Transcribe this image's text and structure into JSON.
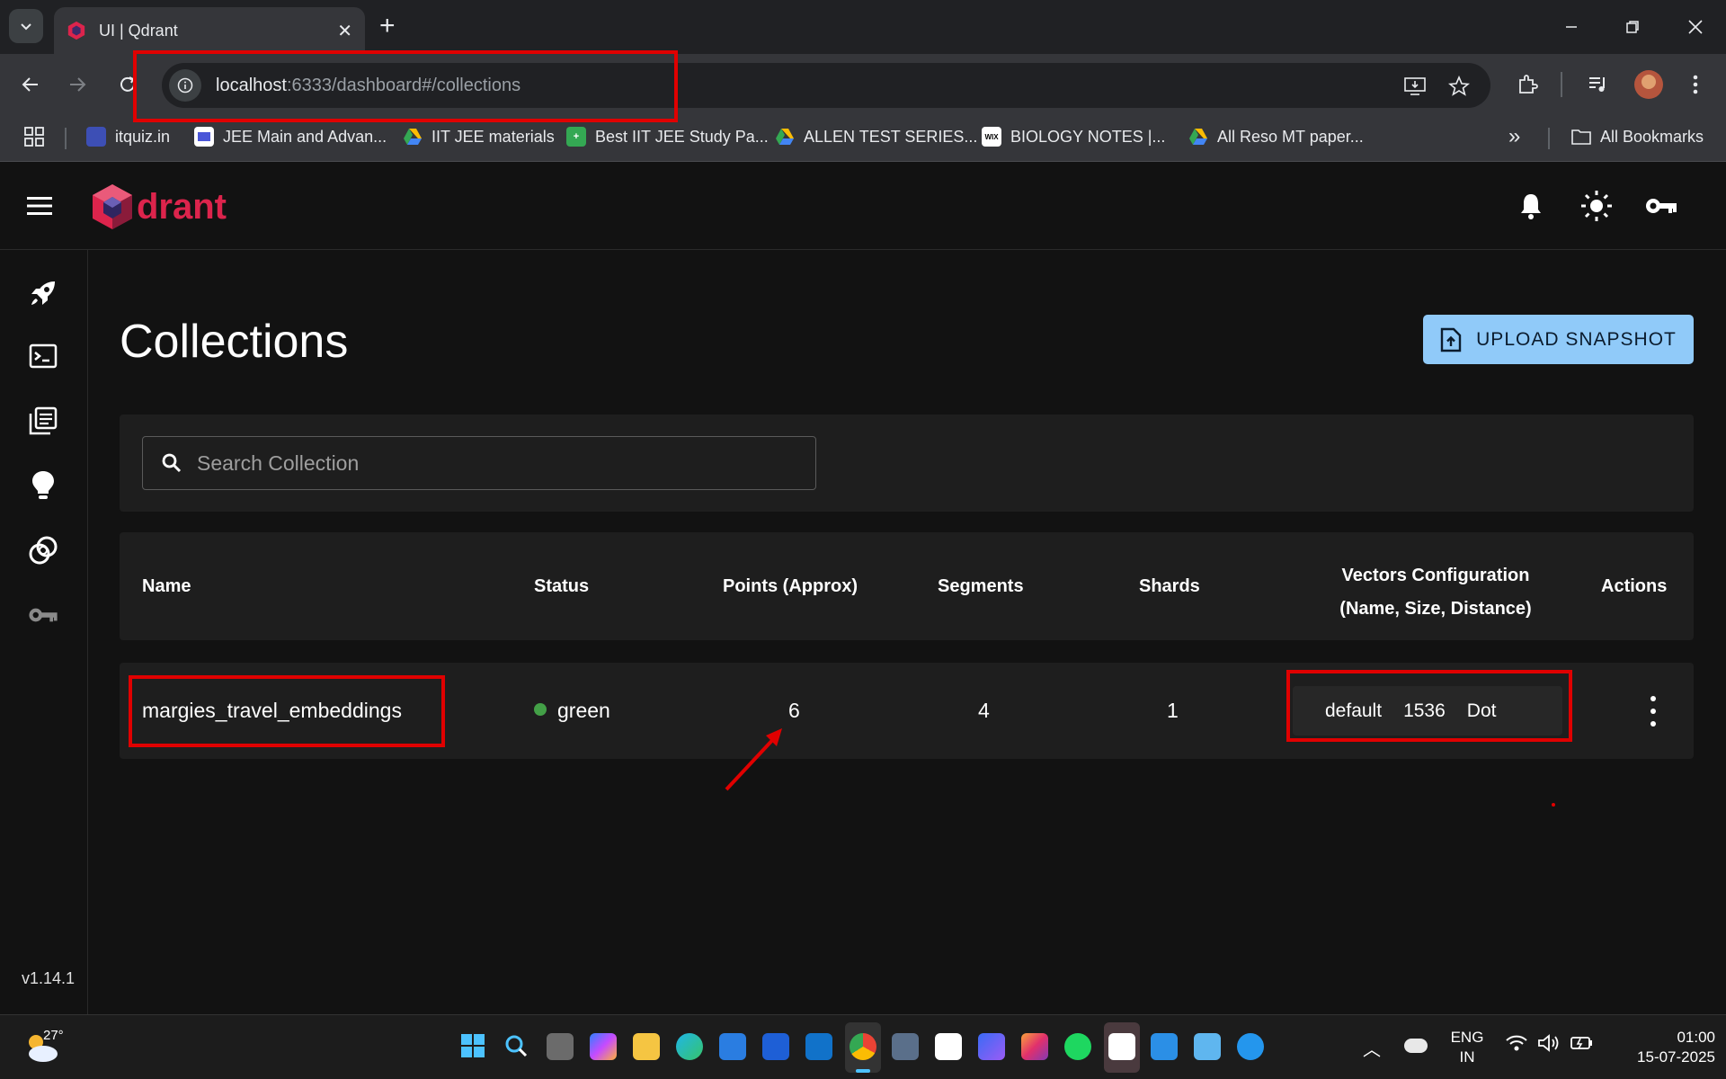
{
  "browser": {
    "tab_title": "UI | Qdrant",
    "url_host": "localhost",
    "url_path": ":6333/dashboard#/collections",
    "bookmarks": [
      {
        "label": "itquiz.in"
      },
      {
        "label": "JEE Main and Advan..."
      },
      {
        "label": "IIT JEE materials"
      },
      {
        "label": "Best IIT JEE Study Pa..."
      },
      {
        "label": "ALLEN TEST SERIES..."
      },
      {
        "label": "BIOLOGY NOTES |..."
      },
      {
        "label": "All Reso MT paper..."
      }
    ],
    "all_bookmarks": "All Bookmarks",
    "wix_icon": "WIX"
  },
  "app": {
    "logo_text": "drant",
    "version": "v1.14.1",
    "page_title": "Collections",
    "upload_button": "UPLOAD SNAPSHOT",
    "search_placeholder": "Search Collection"
  },
  "table": {
    "headers": {
      "name": "Name",
      "status": "Status",
      "points": "Points (Approx)",
      "segments": "Segments",
      "shards": "Shards",
      "vectors_line1": "Vectors Configuration",
      "vectors_line2": "(Name, Size, Distance)",
      "actions": "Actions"
    },
    "rows": [
      {
        "name": "margies_travel_embeddings",
        "status": "green",
        "status_color": "#43a047",
        "points": "6",
        "segments": "4",
        "shards": "1",
        "vector_name": "default",
        "vector_size": "1536",
        "vector_distance": "Dot"
      }
    ]
  },
  "taskbar": {
    "temperature": "27°",
    "lang_line1": "ENG",
    "lang_line2": "IN",
    "time": "01:00",
    "date": "15-07-2025"
  },
  "colors": {
    "accent": "#90caf9",
    "logo_red": "#dc244c",
    "annotation_red": "#e00000"
  }
}
